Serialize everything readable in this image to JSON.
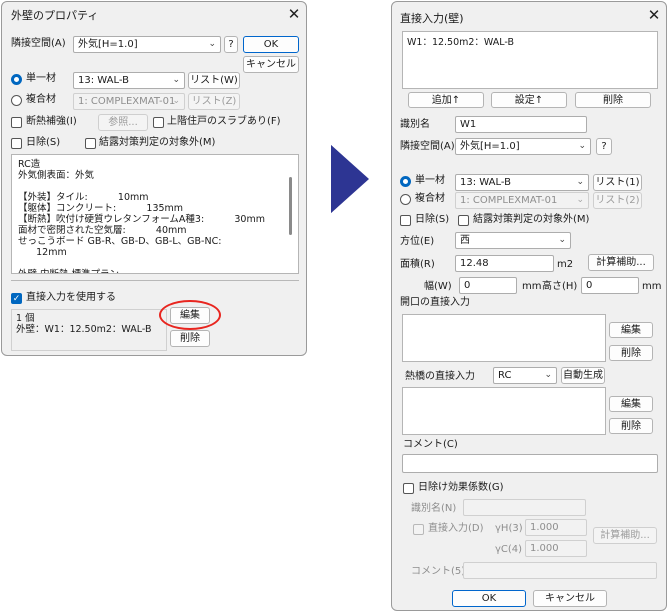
{
  "left": {
    "title": "外壁のプロパティ",
    "close": "✕",
    "adj_label": "隣接空間(A)",
    "adj_value": "外気[H=1.0]",
    "help": "?",
    "ok": "OK",
    "cancel": "キャンセル",
    "single_label": "単一材",
    "single_value": "13: WAL-B",
    "list_w": "リスト(W)",
    "composite_label": "複合材",
    "composite_value": "1: COMPLEXMAT-01",
    "list_z": "リスト(Z)",
    "insulation": "断熱補強(I)",
    "ref_button": "参照...",
    "upper_slab": "上階住戸のスラブあり(F)",
    "sun_label": "日除(S)",
    "condense": "結露対策判定の対象外(M)",
    "info_lines": [
      "RC造",
      "外気側表面：外気",
      "",
      "【外装】タイル:          10mm",
      "【躯体】コンクリート:          135mm",
      "【断熱】吹付け硬質ウレタンフォームA種3:          30mm",
      "面材で密閉された空気層:          40mm",
      "せっこうボード GB-R、GB-D、GB-L、GB-NC:",
      "      12mm",
      "",
      "外壁 内断熱 標準プラン"
    ],
    "direct_use": "直接入力を使用する",
    "direct_lines": [
      "1 個",
      "外壁：W1：12.50m2：WAL-B"
    ],
    "edit": "編集",
    "delete": "削除"
  },
  "right": {
    "title": "直接入力(壁)",
    "close": "✕",
    "list_item": "W1：12.50m2：WAL-B",
    "add": "追加↑",
    "set": "設定↑",
    "delete": "削除",
    "id_label": "識別名",
    "id_value": "W1",
    "adj_label": "隣接空間(A)",
    "adj_value": "外気[H=1.0]",
    "help": "?",
    "single_label": "単一材",
    "single_value": "13: WAL-B",
    "list1": "リスト(1)",
    "composite_label": "複合材",
    "composite_value": "1: COMPLEXMAT-01",
    "list2": "リスト(2)",
    "sun_label": "日除(S)",
    "condense": "結露対策判定の対象外(M)",
    "dir_label": "方位(E)",
    "dir_value": "西",
    "area_label": "面積(R)",
    "area_value": "12.48",
    "area_unit": "m2",
    "calc": "計算補助...",
    "width_label": "幅(W)",
    "width_value": "0",
    "mm1": "mm",
    "height_label": "高さ(H)",
    "height_value": "0",
    "mm2": "mm",
    "opening_label": "開口の直接入力",
    "edit1": "編集",
    "del1": "削除",
    "bridge_label": "熱橋の直接入力",
    "bridge_value": "RC",
    "auto_gen": "自動生成",
    "edit2": "編集",
    "del2": "削除",
    "comment_label": "コメント(C)",
    "sunshade_coef": "日除け効果係数(G)",
    "id2_label": "識別名(N)",
    "direct_in": "直接入力(D)",
    "yh_label": "γH(3)",
    "yh_value": "1.000",
    "yc_label": "γC(4)",
    "yc_value": "1.000",
    "calc2": "計算補助...",
    "comment5_label": "コメント(5)",
    "ok": "OK",
    "cancel": "キャンセル"
  },
  "colors": {
    "accent": "#0067c0",
    "arrow": "#2d3593",
    "highlight": "#e8251f"
  },
  "icons": {
    "arrow": "right-arrow-icon",
    "chevron": "chevron-down-icon"
  }
}
